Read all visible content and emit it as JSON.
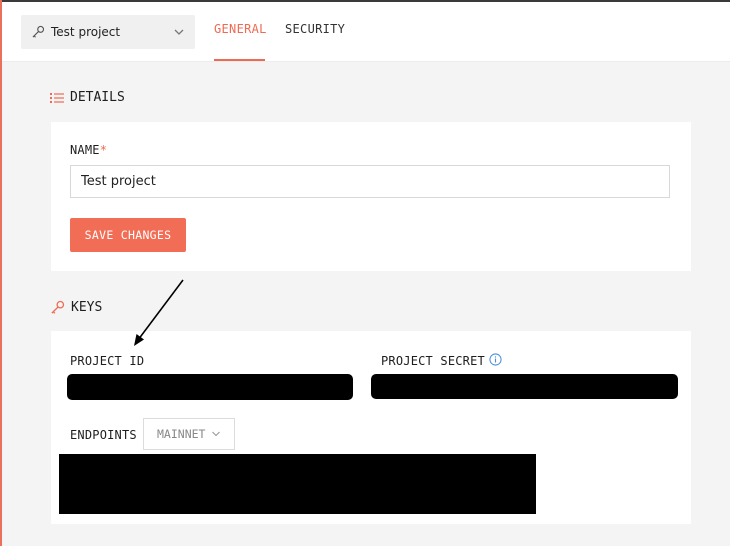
{
  "header": {
    "project_selector": {
      "value": "Test project"
    },
    "tabs": [
      {
        "label": "GENERAL",
        "active": true
      },
      {
        "label": "SECURITY",
        "active": false
      }
    ]
  },
  "details": {
    "title": "DETAILS",
    "name_label": "NAME",
    "required_mark": "*",
    "name_value": "Test project",
    "save_label": "SAVE CHANGES"
  },
  "keys": {
    "title": "KEYS",
    "project_id_label": "PROJECT ID",
    "project_secret_label": "PROJECT SECRET",
    "endpoints_label": "ENDPOINTS",
    "network_value": "MAINNET"
  },
  "icons": {
    "details": "list-icon",
    "keys": "key-icon",
    "info": "info-icon",
    "dropdown": "chevron-down-icon"
  },
  "colors": {
    "accent": "#ef6a52",
    "info": "#4a90d9",
    "redaction": "#000000"
  }
}
